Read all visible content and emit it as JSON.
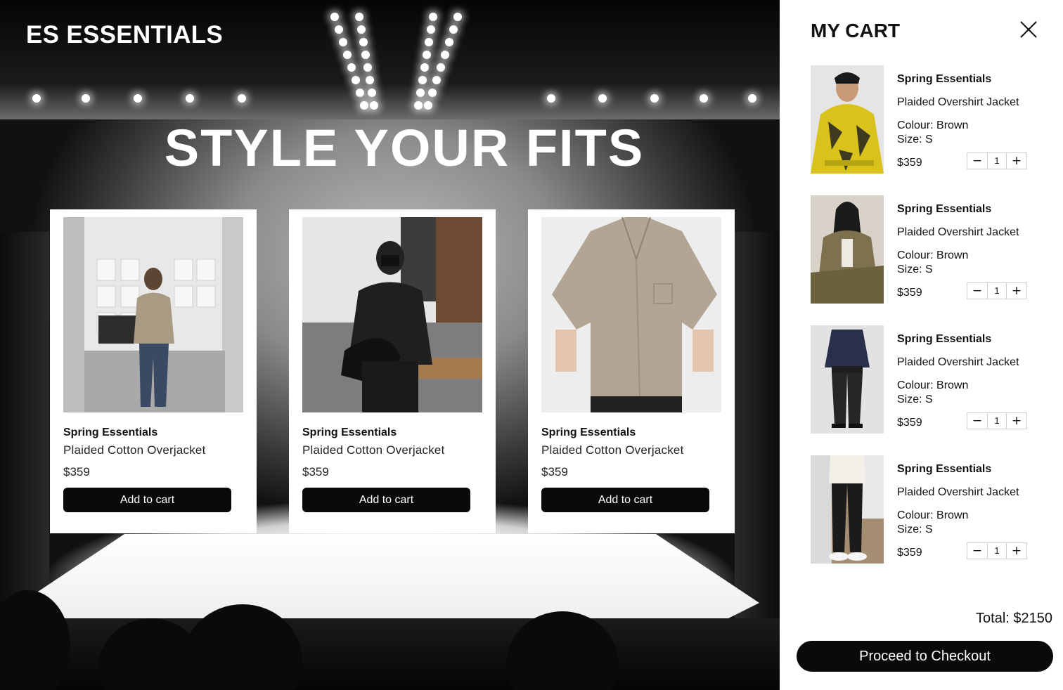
{
  "brand": "ES ESSENTIALS",
  "hero_title": "STYLE YOUR FITS",
  "products": [
    {
      "collection": "Spring Essentials",
      "name": "Plaided Cotton Overjacket",
      "price": "$359",
      "button": "Add to cart",
      "image": "woman-mirror-selfie-beige-sweater"
    },
    {
      "collection": "Spring Essentials",
      "name": "Plaided Cotton Overjacket",
      "price": "$359",
      "button": "Add to cart",
      "image": "man-black-sweatshirt-mask"
    },
    {
      "collection": "Spring Essentials",
      "name": "Plaided Cotton Overjacket",
      "price": "$359",
      "button": "Add to cart",
      "image": "beige-short-sleeve-shirt"
    }
  ],
  "cart": {
    "title": "MY CART",
    "close_icon": "close-icon",
    "items": [
      {
        "collection": "Spring Essentials",
        "name": "Plaided Overshirt Jacket",
        "colour": "Colour: Brown",
        "size": "Size: S",
        "price": "$359",
        "qty": "1",
        "minus": "−",
        "plus": "+",
        "image": "man-yellow-camo-jacket"
      },
      {
        "collection": "Spring Essentials",
        "name": "Plaided Overshirt Jacket",
        "colour": "Colour: Brown",
        "size": "Size: S",
        "price": "$359",
        "qty": "1",
        "minus": "−",
        "plus": "+",
        "image": "woman-olive-oversized-jacket"
      },
      {
        "collection": "Spring Essentials",
        "name": "Plaided Overshirt Jacket",
        "colour": "Colour: Brown",
        "size": "Size: S",
        "price": "$359",
        "qty": "1",
        "minus": "−",
        "plus": "+",
        "image": "man-navy-shirt-black-trousers"
      },
      {
        "collection": "Spring Essentials",
        "name": "Plaided Overshirt Jacket",
        "colour": "Colour: Brown",
        "size": "Size: S",
        "price": "$359",
        "qty": "1",
        "minus": "−",
        "plus": "+",
        "image": "man-white-sweater-black-trousers"
      }
    ],
    "total": "Total: $2150",
    "checkout": "Proceed to Checkout"
  },
  "colors": {
    "accent": "#0a0a0a",
    "panel": "#ffffff"
  }
}
